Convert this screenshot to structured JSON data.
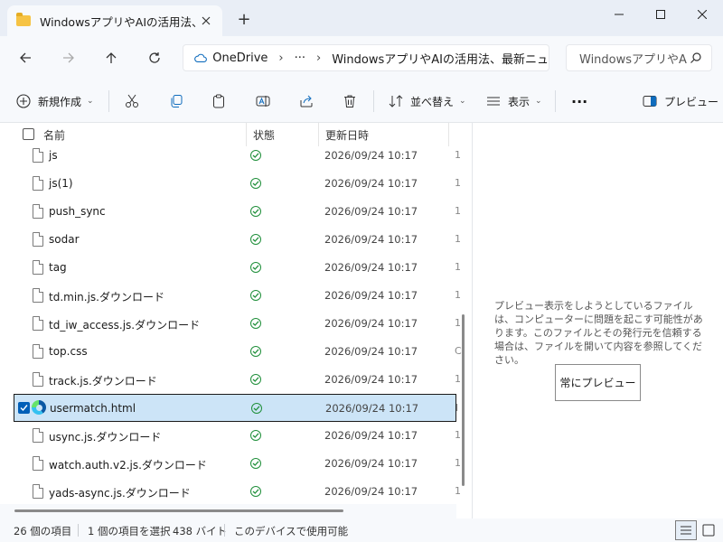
{
  "window": {
    "tab_title": "WindowsアプリやAIの活用法、最",
    "new_tab_symbol": "+",
    "icons": [
      "folder-icon",
      "close-icon",
      "minimize-icon",
      "maximize-icon"
    ]
  },
  "nav": {
    "breadcrumb_root": "OneDrive",
    "breadcrumb_more": "···",
    "breadcrumb_current": "WindowsアプリやAIの活用法、最新ニュ",
    "search_placeholder": "WindowsアプリやA"
  },
  "toolbar": {
    "new_label": "新規作成",
    "sort_label": "並べ替え",
    "view_label": "表示",
    "more_label": "···",
    "preview_label": "プレビュー"
  },
  "columns": {
    "name": "名前",
    "status": "状態",
    "modified": "更新日時"
  },
  "files": [
    {
      "name": "js",
      "date": "2026/09/24 10:17",
      "trunc": "1"
    },
    {
      "name": "js(1)",
      "date": "2026/09/24 10:17",
      "trunc": "1"
    },
    {
      "name": "push_sync",
      "date": "2026/09/24 10:17",
      "trunc": "1"
    },
    {
      "name": "sodar",
      "date": "2026/09/24 10:17",
      "trunc": "1"
    },
    {
      "name": "tag",
      "date": "2026/09/24 10:17",
      "trunc": "1"
    },
    {
      "name": "td.min.js.ダウンロード",
      "date": "2026/09/24 10:17",
      "trunc": "1"
    },
    {
      "name": "td_iw_access.js.ダウンロード",
      "date": "2026/09/24 10:17",
      "trunc": "1"
    },
    {
      "name": "top.css",
      "date": "2026/09/24 10:17",
      "trunc": "C"
    },
    {
      "name": "track.js.ダウンロード",
      "date": "2026/09/24 10:17",
      "trunc": "1"
    },
    {
      "name": "usermatch.html",
      "date": "2026/09/24 10:17",
      "trunc": "I",
      "selected": true
    },
    {
      "name": "usync.js.ダウンロード",
      "date": "2026/09/24 10:17",
      "trunc": "1"
    },
    {
      "name": "watch.auth.v2.js.ダウンロード",
      "date": "2026/09/24 10:17",
      "trunc": "1"
    },
    {
      "name": "yads-async.js.ダウンロード",
      "date": "2026/09/24 10:17",
      "trunc": "1"
    }
  ],
  "preview": {
    "message": "プレビュー表示をしようとしているファイルは、コンピューターに問題を起こす可能性があります。このファイルとその発行元を信頼する場合は、ファイルを開いて内容を参照してください。",
    "always_preview_button": "常にプレビュー"
  },
  "status_bar": {
    "item_count": "26 個の項目",
    "selected": "1 個の項目を選択",
    "size": "438 バイト",
    "availability": "このデバイスで使用可能"
  },
  "colors": {
    "accent": "#005fb8",
    "selected_row": "#cce4f7",
    "synced_green": "#1f8f3a",
    "folder_yellow": "#f6c344"
  }
}
